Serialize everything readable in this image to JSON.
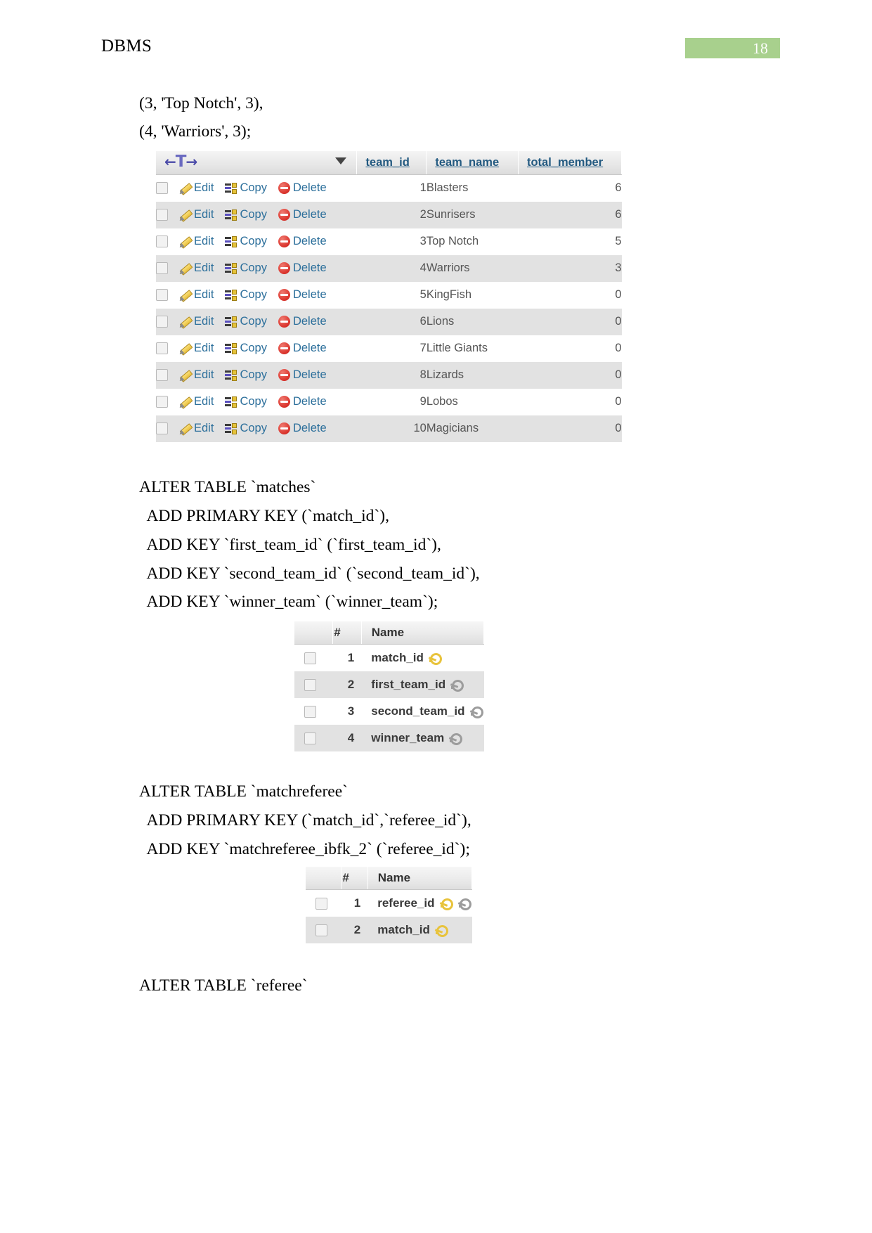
{
  "header": {
    "doc_title": "DBMS",
    "page_number": "18",
    "badge_color": "#a8d08d"
  },
  "sql_lines_top": [
    "(3, 'Top Notch', 3),",
    "(4, 'Warriors', 3);"
  ],
  "teams_table": {
    "nav_left": "←",
    "nav_tee": "T",
    "nav_right": "→",
    "sort_caret": "sort-caret-icon",
    "columns": [
      "team_id",
      "team_name",
      "total_member"
    ],
    "actions": {
      "edit": "Edit",
      "copy": "Copy",
      "delete": "Delete"
    },
    "rows": [
      {
        "team_id": "1",
        "team_name": "Blasters",
        "total_member": "6"
      },
      {
        "team_id": "2",
        "team_name": "Sunrisers",
        "total_member": "6"
      },
      {
        "team_id": "3",
        "team_name": "Top Notch",
        "total_member": "5"
      },
      {
        "team_id": "4",
        "team_name": "Warriors",
        "total_member": "3"
      },
      {
        "team_id": "5",
        "team_name": "KingFish",
        "total_member": "0"
      },
      {
        "team_id": "6",
        "team_name": "Lions",
        "total_member": "0"
      },
      {
        "team_id": "7",
        "team_name": "Little Giants",
        "total_member": "0"
      },
      {
        "team_id": "8",
        "team_name": "Lizards",
        "total_member": "0"
      },
      {
        "team_id": "9",
        "team_name": "Lobos",
        "total_member": "0"
      },
      {
        "team_id": "10",
        "team_name": "Magicians",
        "total_member": "0"
      }
    ]
  },
  "sql_block_matches": [
    "ALTER TABLE `matches`",
    "  ADD PRIMARY KEY (`match_id`),",
    "  ADD KEY `first_team_id` (`first_team_id`),",
    "  ADD KEY `second_team_id` (`second_team_id`),",
    "  ADD KEY `winner_team` (`winner_team`);"
  ],
  "matches_struct": {
    "columns": [
      "#",
      "Name"
    ],
    "rows": [
      {
        "num": "1",
        "name": "match_id",
        "keys": [
          "primary"
        ]
      },
      {
        "num": "2",
        "name": "first_team_id",
        "keys": [
          "index"
        ]
      },
      {
        "num": "3",
        "name": "second_team_id",
        "keys": [
          "index"
        ]
      },
      {
        "num": "4",
        "name": "winner_team",
        "keys": [
          "index"
        ]
      }
    ]
  },
  "sql_block_matchreferee": [
    "ALTER TABLE `matchreferee`",
    "  ADD PRIMARY KEY (`match_id`,`referee_id`),",
    "  ADD KEY `matchreferee_ibfk_2` (`referee_id`);"
  ],
  "matchreferee_struct": {
    "columns": [
      "#",
      "Name"
    ],
    "rows": [
      {
        "num": "1",
        "name": "referee_id",
        "keys": [
          "primary",
          "index"
        ]
      },
      {
        "num": "2",
        "name": "match_id",
        "keys": [
          "primary"
        ]
      }
    ]
  },
  "sql_block_referee": [
    "ALTER TABLE `referee`"
  ]
}
